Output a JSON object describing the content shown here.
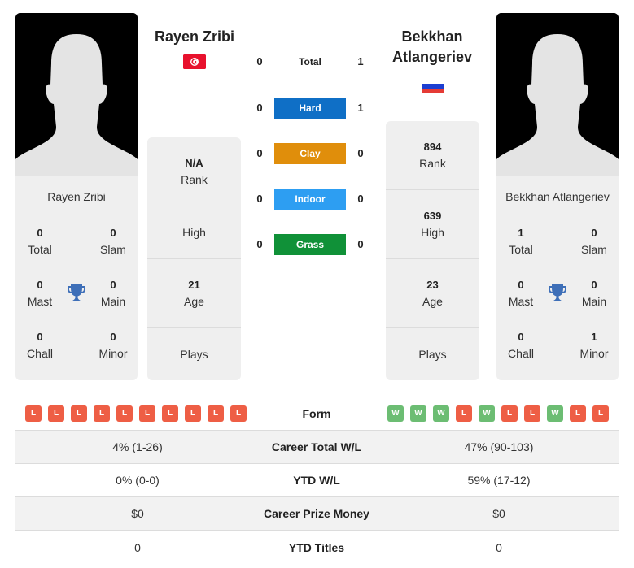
{
  "colors": {
    "hard": "#0f6fc6",
    "clay": "#e08e0b",
    "indoor": "#2d9ef2",
    "grass": "#109138",
    "win": "#6cbd73",
    "loss": "#ee5e45",
    "trophy": "#3e6fb8"
  },
  "player1": {
    "name": "Rayen Zribi",
    "card_name": "Rayen Zribi",
    "flag": "tunisia-flag",
    "titles": {
      "total": {
        "value": "0",
        "label": "Total"
      },
      "slam": {
        "value": "0",
        "label": "Slam"
      },
      "mast": {
        "value": "0",
        "label": "Mast"
      },
      "main": {
        "value": "0",
        "label": "Main"
      },
      "chall": {
        "value": "0",
        "label": "Chall"
      },
      "minor": {
        "value": "0",
        "label": "Minor"
      }
    },
    "info": {
      "rank": {
        "value": "N/A",
        "label": "Rank"
      },
      "high": {
        "value": "",
        "label": "High"
      },
      "age": {
        "value": "21",
        "label": "Age"
      },
      "plays": {
        "value": "",
        "label": "Plays"
      }
    },
    "form": [
      "L",
      "L",
      "L",
      "L",
      "L",
      "L",
      "L",
      "L",
      "L",
      "L"
    ]
  },
  "player2": {
    "name": "Bekkhan Atlangeriev",
    "card_name": "Bekkhan Atlangeriev",
    "flag": "russia-flag",
    "titles": {
      "total": {
        "value": "1",
        "label": "Total"
      },
      "slam": {
        "value": "0",
        "label": "Slam"
      },
      "mast": {
        "value": "0",
        "label": "Mast"
      },
      "main": {
        "value": "0",
        "label": "Main"
      },
      "chall": {
        "value": "0",
        "label": "Chall"
      },
      "minor": {
        "value": "1",
        "label": "Minor"
      }
    },
    "info": {
      "rank": {
        "value": "894",
        "label": "Rank"
      },
      "high": {
        "value": "639",
        "label": "High"
      },
      "age": {
        "value": "23",
        "label": "Age"
      },
      "plays": {
        "value": "",
        "label": "Plays"
      }
    },
    "form": [
      "W",
      "W",
      "W",
      "L",
      "W",
      "L",
      "L",
      "W",
      "L",
      "L"
    ]
  },
  "h2h": [
    {
      "surface": "Total",
      "p1": "0",
      "p2": "1"
    },
    {
      "surface": "Hard",
      "p1": "0",
      "p2": "1"
    },
    {
      "surface": "Clay",
      "p1": "0",
      "p2": "0"
    },
    {
      "surface": "Indoor",
      "p1": "0",
      "p2": "0"
    },
    {
      "surface": "Grass",
      "p1": "0",
      "p2": "0"
    }
  ],
  "stats": {
    "form_label": "Form",
    "rows": [
      {
        "label": "Career Total W/L",
        "p1": "4% (1-26)",
        "p2": "47% (90-103)"
      },
      {
        "label": "YTD W/L",
        "p1": "0% (0-0)",
        "p2": "59% (17-12)"
      },
      {
        "label": "Career Prize Money",
        "p1": "$0",
        "p2": "$0"
      },
      {
        "label": "YTD Titles",
        "p1": "0",
        "p2": "0"
      }
    ]
  }
}
